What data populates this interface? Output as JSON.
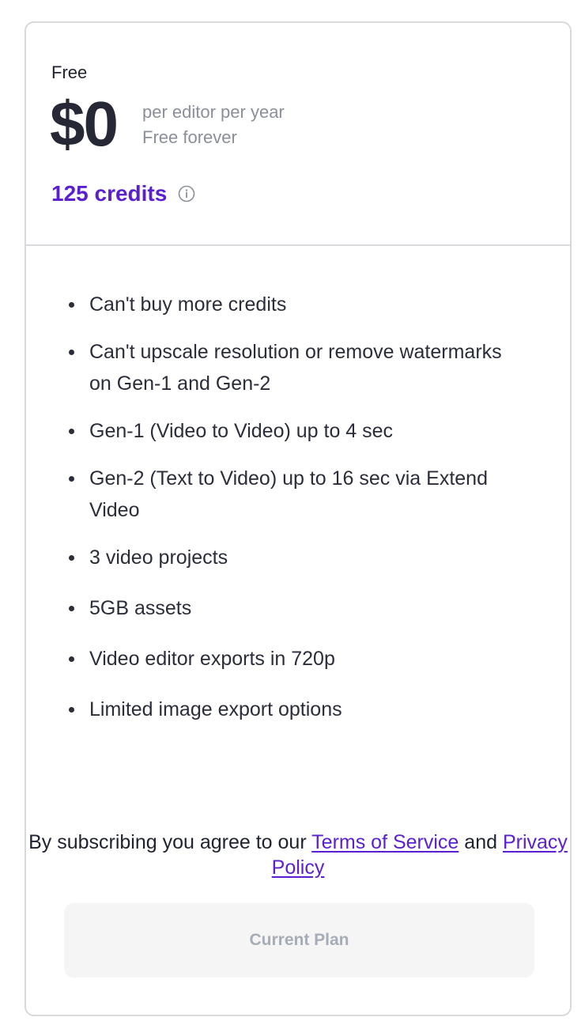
{
  "plan": {
    "name": "Free",
    "price": "$0",
    "price_period": "per editor per year",
    "price_note": "Free forever",
    "credits": "125 credits"
  },
  "features": [
    "Can't buy more credits",
    "Can't upscale resolution or remove watermarks on Gen-1 and Gen-2",
    "Gen-1 (Video to Video) up to 4 sec",
    "Gen-2 (Text to Video) up to 16 sec via Extend Video",
    "3 video projects",
    "5GB assets",
    "Video editor exports in 720p",
    "Limited image export options"
  ],
  "terms": {
    "prefix": "By subscribing you agree to our ",
    "terms_link": "Terms of Service",
    "middle": " and ",
    "privacy_link": "Privacy Policy"
  },
  "cta": {
    "label": "Current Plan"
  },
  "colors": {
    "accent": "#5a1fd1",
    "text": "#2b2d3a",
    "muted": "#8a8f99",
    "border": "#d9d9dd",
    "button_bg": "#f5f5f6",
    "button_text": "#a7adb6"
  },
  "icons": {
    "credits_info": "info-circle-icon"
  }
}
